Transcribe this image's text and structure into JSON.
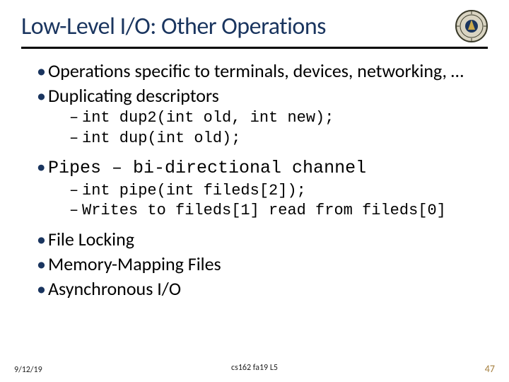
{
  "title": "Low-Level I/O: Other Operations",
  "bullets": {
    "b1_1": "Operations specific to terminals, devices, networking, …",
    "b1_2": "Duplicating descriptors",
    "b2_1": "int dup2(int old, int new);",
    "b2_2": "int dup(int old);",
    "b1_3": "Pipes – bi-directional channel",
    "b2_3": "int pipe(int fileds[2]);",
    "b2_4": "Writes to fileds[1] read from fileds[0]",
    "b1_4": "File Locking",
    "b1_5": "Memory-Mapping Files",
    "b1_6": "Asynchronous I/O"
  },
  "footer": {
    "date": "9/12/19",
    "center": "cs162 fa19 L5",
    "page": "47"
  }
}
